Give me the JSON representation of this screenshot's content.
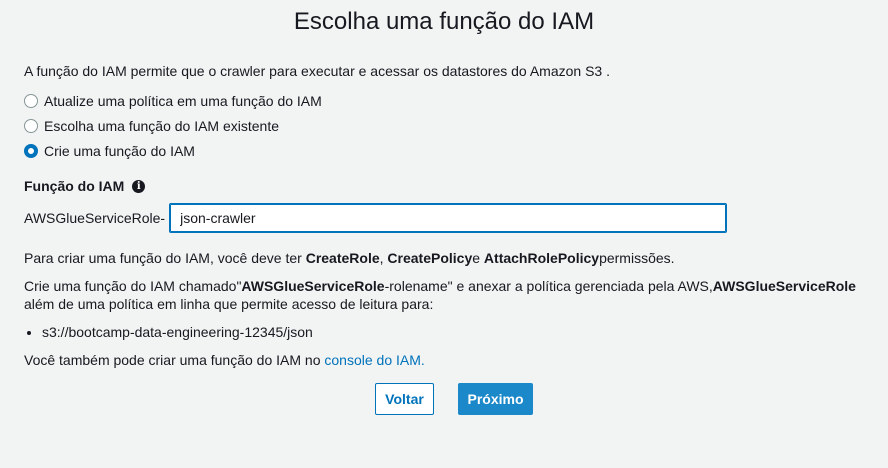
{
  "title": "Escolha uma função do IAM",
  "intro": "A função do IAM permite que o crawler para executar e acessar os datastores do Amazon S3 .",
  "options": [
    {
      "label": "Atualize uma política em uma função do IAM",
      "selected": false
    },
    {
      "label": "Escolha uma função do IAM existente",
      "selected": false
    },
    {
      "label": "Crie uma função do IAM",
      "selected": true
    }
  ],
  "role": {
    "heading": "Função do IAM",
    "prefix": "AWSGlueServiceRole-",
    "value": "json-crawler"
  },
  "permissions": {
    "text1": "Para criar uma função do IAM, você deve ter ",
    "perm1": "CreateRole",
    "sep1": ", ",
    "perm2": "CreatePolicy",
    "sep2": "e ",
    "perm3": "AttachRolePolicy",
    "text2": "permissões."
  },
  "create_info": {
    "text1": "Crie uma função do IAM chamado\"",
    "role_bold": "AWSGlueServiceRole",
    "text2": "-rolename\" e anexar a política gerenciada pela AWS,",
    "policy_bold": "AWSGlueServiceRole",
    "line2": "além de uma política em linha que permite acesso de leitura para:"
  },
  "buckets": [
    "s3://bootcamp-data-engineering-12345/json"
  ],
  "console": {
    "text": "Você também pode criar uma função do IAM no ",
    "link": "console do IAM."
  },
  "buttons": {
    "back": "Voltar",
    "next": "Próximo"
  },
  "colors": {
    "accent": "#0073bb",
    "primary_button": "#1b88c9",
    "background": "#f2f3f3"
  }
}
